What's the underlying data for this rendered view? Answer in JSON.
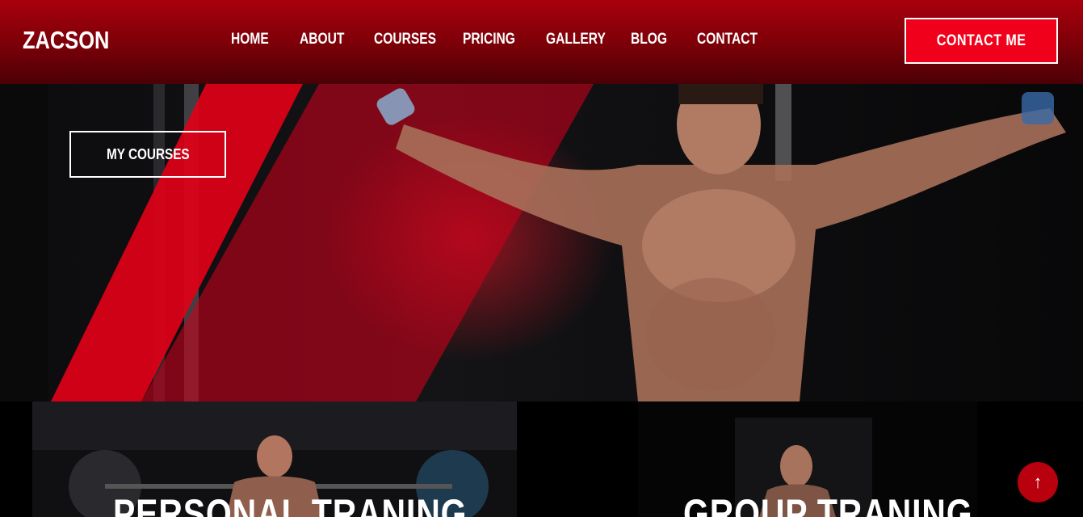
{
  "header": {
    "logo": "ZACSON",
    "nav": [
      "HOME",
      "ABOUT",
      "COURSES",
      "PRICING",
      "GALLERY",
      "BLOG",
      "CONTACT"
    ],
    "cta": "CONTACT ME"
  },
  "hero": {
    "button": "MY COURSES"
  },
  "cards": [
    {
      "title": "PERSONAL TRANING"
    },
    {
      "title": "GROUP TRANING"
    }
  ],
  "scroll_top": {
    "icon": "arrow-up-icon",
    "glyph": "↑"
  },
  "colors": {
    "accent": "#f0001a",
    "header": "#8a000a",
    "background": "#000000"
  }
}
